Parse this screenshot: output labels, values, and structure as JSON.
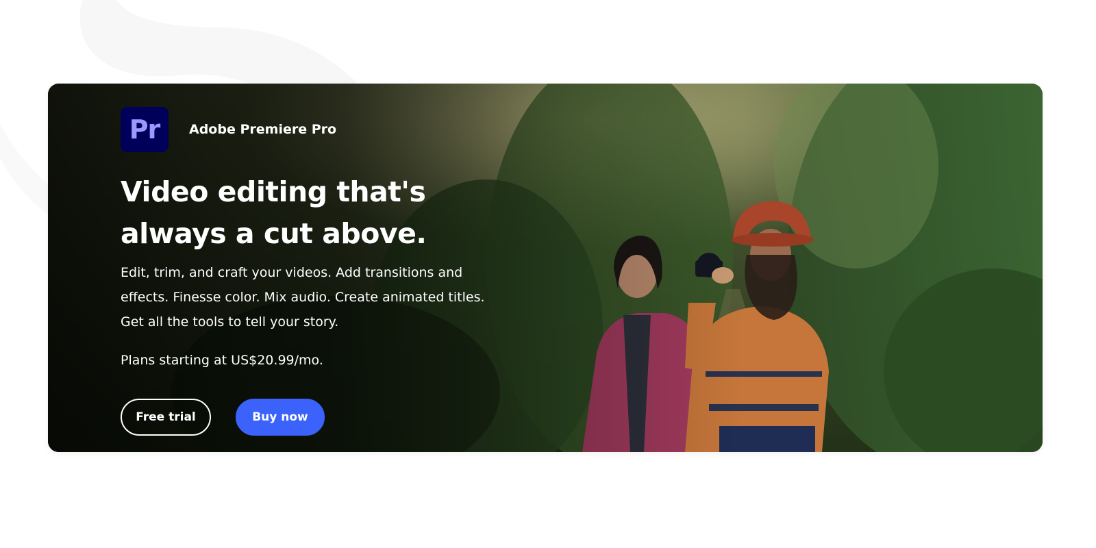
{
  "product": {
    "logo_text": "Pr",
    "name": "Adobe Premiere Pro"
  },
  "hero": {
    "headline": "Video editing that's always a cut above.",
    "description": "Edit, trim, and craft your videos. Add transitions and effects. Finesse color. Mix audio. Create animated titles. Get all the tools to tell your story.",
    "price_text": "Plans starting at US$20.99/mo.",
    "image_icon": "forest-photographers-image"
  },
  "actions": {
    "free_trial_label": "Free trial",
    "buy_now_label": "Buy now"
  },
  "colors": {
    "logo_bg": "#00005b",
    "logo_text": "#9999ff",
    "primary_button": "#3b63fb"
  }
}
